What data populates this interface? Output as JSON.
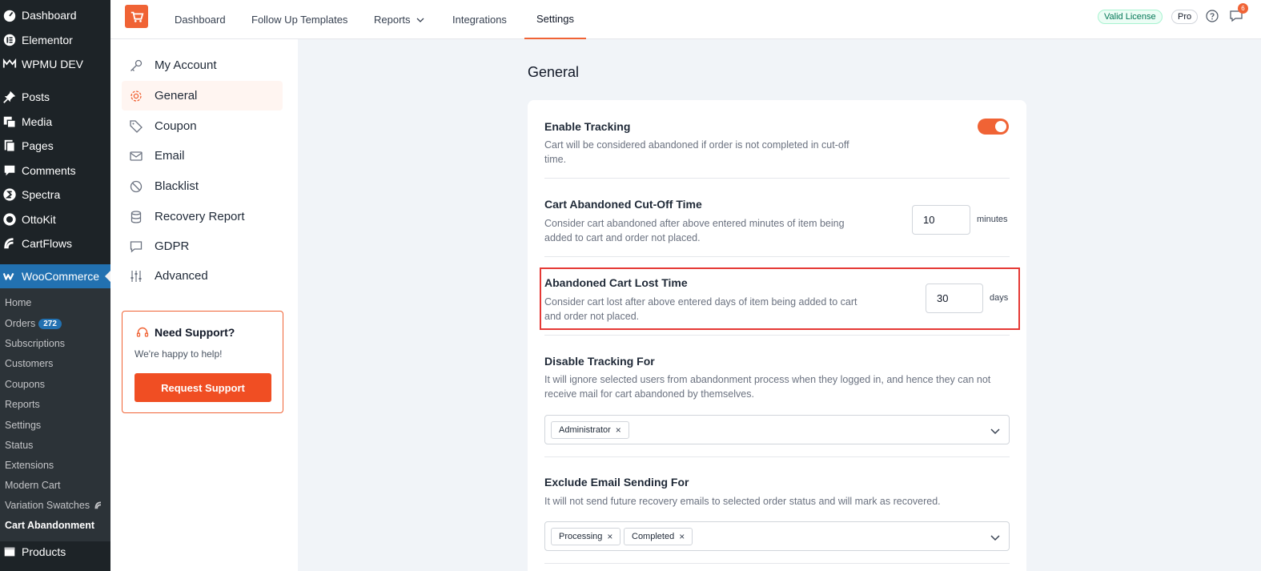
{
  "wp_menu": {
    "top_items": [
      {
        "label": "Dashboard",
        "icon": "dashboard-icon"
      },
      {
        "label": "Elementor",
        "icon": "elementor-icon"
      },
      {
        "label": "WPMU DEV",
        "icon": "wpmudev-icon"
      },
      {
        "label": "Posts",
        "icon": "pin-icon"
      },
      {
        "label": "Media",
        "icon": "media-icon"
      },
      {
        "label": "Pages",
        "icon": "pages-icon"
      },
      {
        "label": "Comments",
        "icon": "comment-icon"
      },
      {
        "label": "Spectra",
        "icon": "spectra-icon"
      },
      {
        "label": "OttoKit",
        "icon": "ottokit-icon"
      },
      {
        "label": "CartFlows",
        "icon": "cartflows-icon"
      }
    ],
    "woocommerce": {
      "label": "WooCommerce",
      "icon": "woocommerce-icon"
    },
    "submenu": [
      {
        "label": "Home"
      },
      {
        "label": "Orders",
        "badge": "272"
      },
      {
        "label": "Subscriptions"
      },
      {
        "label": "Customers"
      },
      {
        "label": "Coupons"
      },
      {
        "label": "Reports"
      },
      {
        "label": "Settings"
      },
      {
        "label": "Status"
      },
      {
        "label": "Extensions"
      },
      {
        "label": "Modern Cart"
      },
      {
        "label": "Variation Swatches"
      },
      {
        "label": "Cart Abandonment",
        "current": true
      }
    ],
    "products": {
      "label": "Products",
      "icon": "products-icon"
    }
  },
  "topnav": {
    "tabs": [
      "Dashboard",
      "Follow Up Templates",
      "Reports",
      "Integrations",
      "Settings"
    ],
    "active_tab": "Settings",
    "license_badge": "Valid License",
    "plan_badge": "Pro",
    "notification_count": "6"
  },
  "settings_nav": {
    "items": [
      {
        "label": "My Account",
        "icon": "key-icon"
      },
      {
        "label": "General",
        "icon": "gear-icon",
        "active": true
      },
      {
        "label": "Coupon",
        "icon": "tag-icon"
      },
      {
        "label": "Email",
        "icon": "mail-icon"
      },
      {
        "label": "Blacklist",
        "icon": "ban-icon"
      },
      {
        "label": "Recovery Report",
        "icon": "database-icon"
      },
      {
        "label": "GDPR",
        "icon": "chat-icon"
      },
      {
        "label": "Advanced",
        "icon": "sliders-icon"
      }
    ],
    "support": {
      "title": "Need Support?",
      "subtitle": "We're happy to help!",
      "button": "Request Support"
    }
  },
  "main": {
    "title": "General",
    "enable_tracking": {
      "title": "Enable Tracking",
      "desc_line1": "Cart will be considered abandoned if order is not completed in cut-off",
      "desc_line2": "time.",
      "enabled": true
    },
    "cutoff": {
      "title": "Cart Abandoned Cut-Off Time",
      "desc_line1": "Consider cart abandoned after above entered minutes of item being",
      "desc_line2": "added to cart and order not placed.",
      "value": "10",
      "unit": "minutes"
    },
    "lost_time": {
      "title": "Abandoned Cart Lost Time",
      "desc_line1": "Consider cart lost after above entered days of item being added to cart",
      "desc_line2": "and order not placed.",
      "value": "30",
      "unit": "days"
    },
    "disable_tracking": {
      "title": "Disable Tracking For",
      "desc_line1": "It will ignore selected users from abandonment process when they logged in, and hence they can not",
      "desc_line2": "receive mail for cart abandoned by themselves.",
      "tags": [
        "Administrator"
      ]
    },
    "exclude_email": {
      "title": "Exclude Email Sending For",
      "desc_line1": "It will not send future recovery emails to selected order status and will mark as recovered.",
      "tags": [
        "Processing",
        "Completed"
      ]
    }
  },
  "colors": {
    "accent": "#f06335",
    "wp_sidebar": "#1d2327",
    "wp_active": "#2271b1",
    "highlight": "#e53935"
  }
}
